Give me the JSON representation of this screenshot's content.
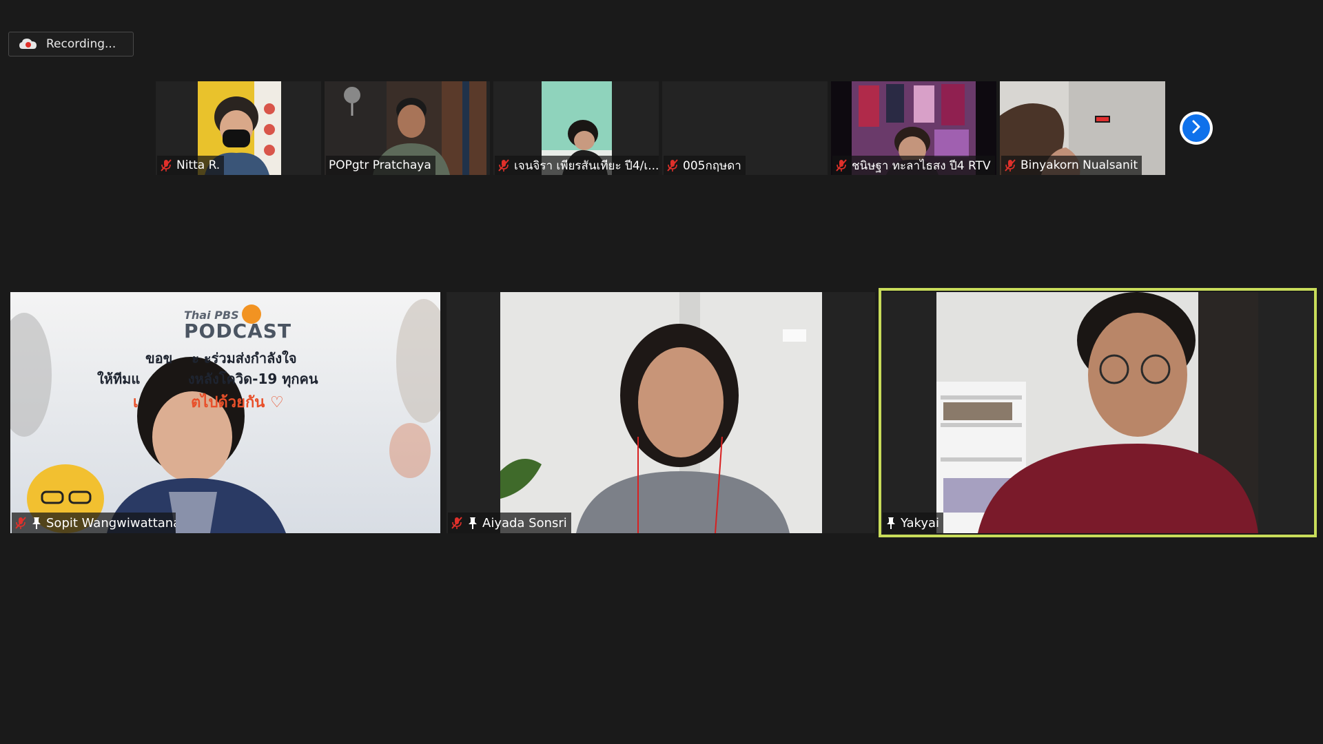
{
  "recording": {
    "label": "Recording...",
    "icon": "cloud-record-icon"
  },
  "thumbnails": [
    {
      "name": "Nitta R.",
      "muted": true
    },
    {
      "name": "POPgtr Pratchaya",
      "muted": false
    },
    {
      "name": "เจนจิรา เพียรสันเทียะ ปี4/เ...",
      "muted": true
    },
    {
      "name": "005กฤษดา",
      "muted": true
    },
    {
      "name": "ชนิษฐา ทะลาไธสง ปี4 RTV",
      "muted": true
    },
    {
      "name": "Binyakorn Nualsanit",
      "muted": true
    }
  ],
  "next_button": {
    "icon": "chevron-right-icon"
  },
  "main_tiles": [
    {
      "name": "Sopit Wangwiwattana",
      "muted": true,
      "pinned": true,
      "background_text": {
        "brand": "Thai PBS",
        "podcast": "PODCAST",
        "line1": "ขอข    ะ ะร่วมส่งกำลังใจ",
        "line2": "ให้ทีมแ          งหลังโควิด-19 ทุกคน",
        "line3": "เ          ตไปด้วยกัน ♡"
      }
    },
    {
      "name": "Aiyada Sonsri",
      "muted": true,
      "pinned": true
    },
    {
      "name": "Yakyai",
      "muted": false,
      "pinned": true,
      "active_speaker": true
    }
  ],
  "colors": {
    "background": "#1a1a1a",
    "active_speaker_border": "#c8dc5a",
    "muted_icon": "#e0302a",
    "next_button": "#0e71eb"
  }
}
